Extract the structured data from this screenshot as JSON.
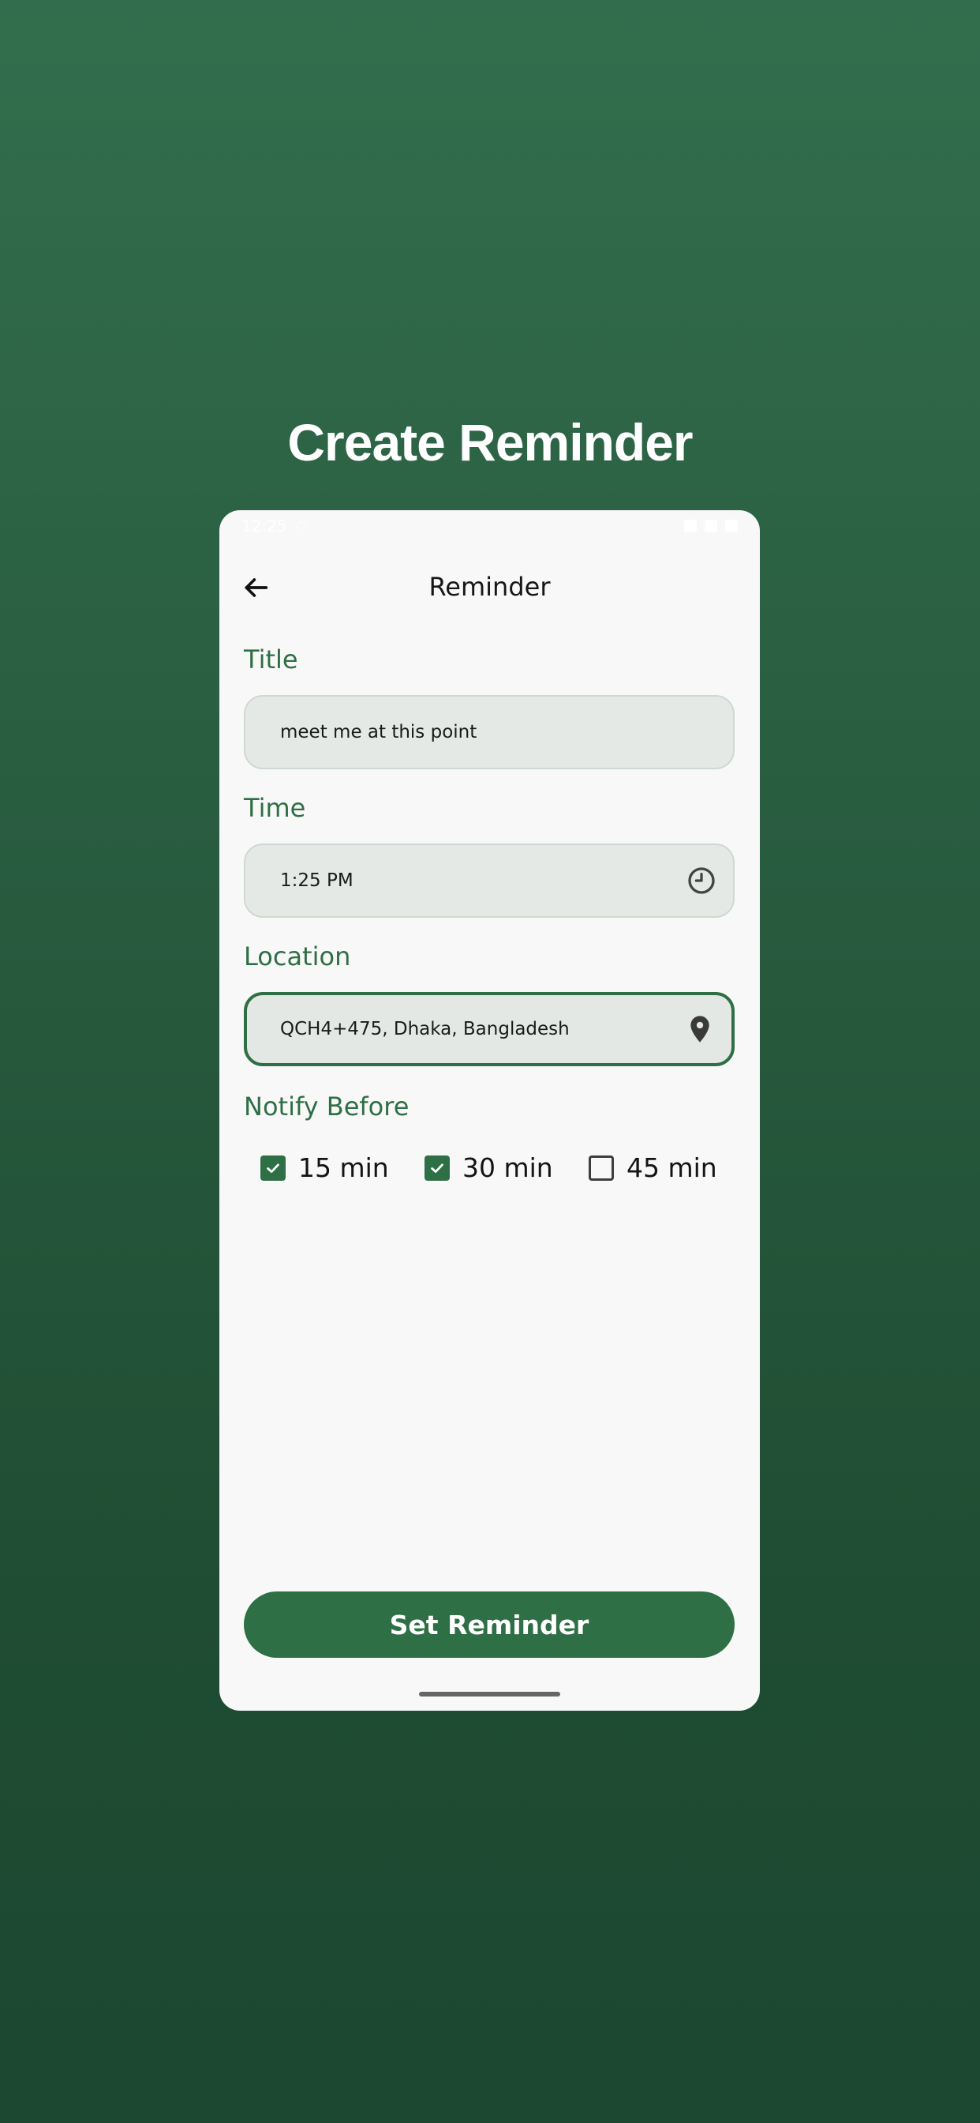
{
  "page": {
    "title": "Create Reminder"
  },
  "status_bar": {
    "time": "12:25"
  },
  "screen": {
    "title": "Reminder"
  },
  "sections": {
    "title_label": "Title",
    "time_label": "Time",
    "location_label": "Location",
    "notify_label": "Notify Before"
  },
  "fields": {
    "title_value": "meet me at this point",
    "time_value": "1:25 PM",
    "location_value": "QCH4+475, Dhaka, Bangladesh"
  },
  "notify_options": [
    {
      "label": "15 min",
      "checked": true
    },
    {
      "label": "30 min",
      "checked": true
    },
    {
      "label": "45 min",
      "checked": false
    }
  ],
  "actions": {
    "submit_label": "Set Reminder"
  },
  "icons": {
    "back": "arrow-left-icon",
    "time": "clock-icon",
    "location": "location-pin-icon",
    "check": "check-icon"
  },
  "colors": {
    "accent": "#2f6f45",
    "field_fill": "#e5e9e6"
  }
}
